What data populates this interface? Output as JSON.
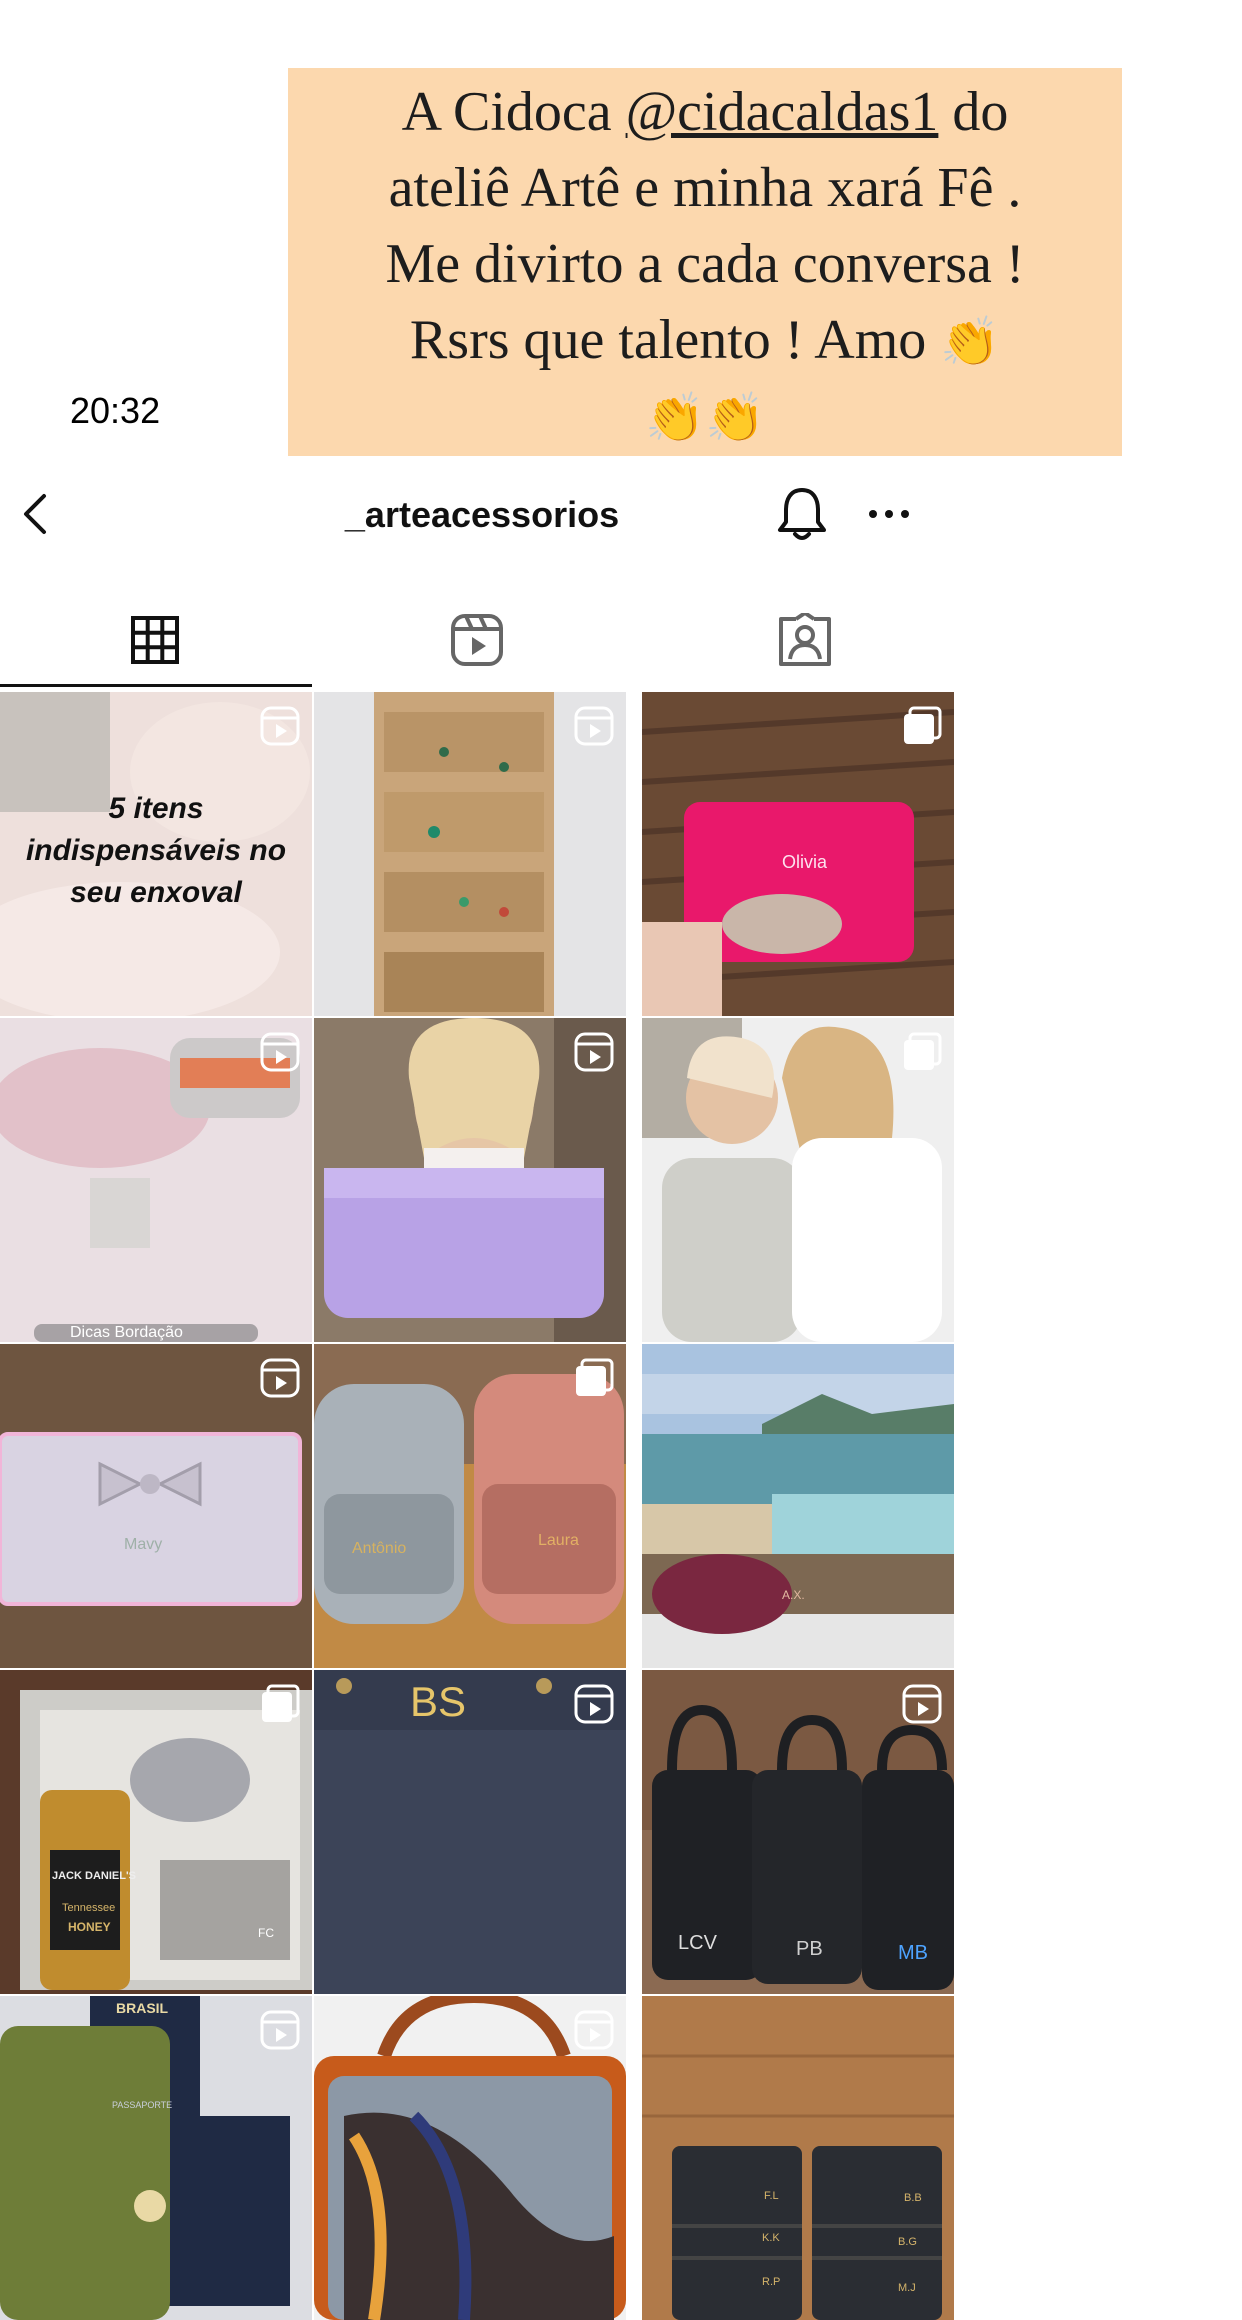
{
  "status_bar": {
    "time": "20:32"
  },
  "story_caption": {
    "line1_pre": "A Cidoca ",
    "mention": "@cidacaldas1",
    "line1_post": " do",
    "line2": "ateliê Artê e minha xará Fê .",
    "line3": "Me divirto a cada conversa !",
    "line4": "Rsrs que talento ! Amo ",
    "clap_emoji": "👏",
    "claps_line5": "👏👏"
  },
  "header": {
    "username": "_arteacessorios",
    "back_icon": "chevron-left-icon",
    "bell_icon": "bell-icon",
    "more_icon": "more-horizontal-icon"
  },
  "tabs": [
    {
      "name": "posts",
      "icon": "grid-icon",
      "active": true
    },
    {
      "name": "reels",
      "icon": "reels-icon",
      "active": false
    },
    {
      "name": "tagged",
      "icon": "tagged-user-icon",
      "active": false
    }
  ],
  "posts": [
    {
      "type": "reel",
      "overlay_text": [
        "5 itens",
        "indispensáveis no",
        "seu enxoval"
      ]
    },
    {
      "type": "reel"
    },
    {
      "type": "carousel",
      "overlay_text": [
        "Olivia"
      ]
    },
    {
      "type": "reel",
      "overlay_text": [
        "Dicas Bordação"
      ]
    },
    {
      "type": "reel"
    },
    {
      "type": "carousel"
    },
    {
      "type": "reel",
      "overlay_text": [
        "Mavy"
      ]
    },
    {
      "type": "carousel",
      "overlay_text": [
        "Antônio",
        "Laura"
      ]
    },
    {
      "type": "none",
      "overlay_text": [
        "A.X."
      ]
    },
    {
      "type": "carousel",
      "overlay_text": [
        "FC",
        "JACK DANIEL'S",
        "Tennessee",
        "HONEY"
      ]
    },
    {
      "type": "reel",
      "overlay_text": [
        "BS"
      ]
    },
    {
      "type": "reel",
      "overlay_text": [
        "LCV",
        "PB",
        "MB"
      ]
    },
    {
      "type": "reel",
      "overlay_text": [
        "BRASIL",
        "PASSAPORTE"
      ]
    },
    {
      "type": "reel"
    },
    {
      "type": "none",
      "overlay_text": [
        "F.L",
        "B.B",
        "K.K",
        "B.G",
        "R.P",
        "M.J"
      ]
    }
  ],
  "colors": {
    "caption_bg": "#fcd8ae",
    "text": "#111111",
    "accent_pink": "#e9186b"
  }
}
